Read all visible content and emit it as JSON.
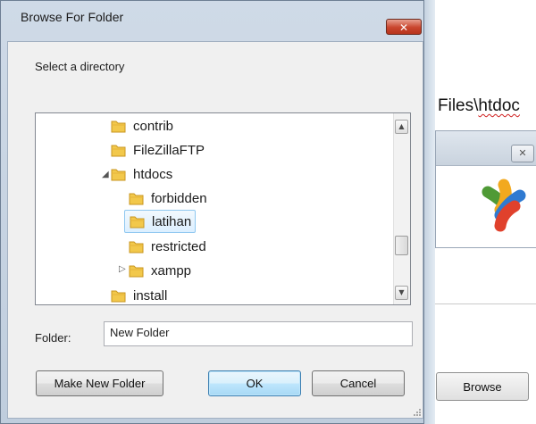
{
  "dialog": {
    "title": "Browse For Folder",
    "close_symbol": "✕",
    "prompt": "Select a directory",
    "tree": {
      "rows": [
        {
          "label": "contrib",
          "expander": "",
          "selected": false
        },
        {
          "label": "FileZillaFTP",
          "expander": "",
          "selected": false
        },
        {
          "label": "htdocs",
          "expander": "◢",
          "selected": false
        },
        {
          "label": "forbidden",
          "expander": "",
          "selected": false
        },
        {
          "label": "latihan",
          "expander": "",
          "selected": true
        },
        {
          "label": "restricted",
          "expander": "",
          "selected": false
        },
        {
          "label": "xampp",
          "expander": "▷",
          "selected": false
        },
        {
          "label": "install",
          "expander": "",
          "selected": false
        }
      ],
      "scroll_up_symbol": "▲",
      "scroll_down_symbol": "▼"
    },
    "folder_label": "Folder:",
    "folder_value": "New Folder",
    "buttons": {
      "make_new_folder": "Make New Folder",
      "ok": "OK",
      "cancel": "Cancel"
    }
  },
  "background": {
    "path_plain": "Files\\",
    "path_squiggle": "htdoc",
    "browse_button": "Browse",
    "close_symbol": "✕"
  },
  "colors": {
    "title_bar": "#c9d6e5",
    "close_red": "#c9452d",
    "folder_yellow": "#f2c84b",
    "selection": "#dcefff"
  }
}
